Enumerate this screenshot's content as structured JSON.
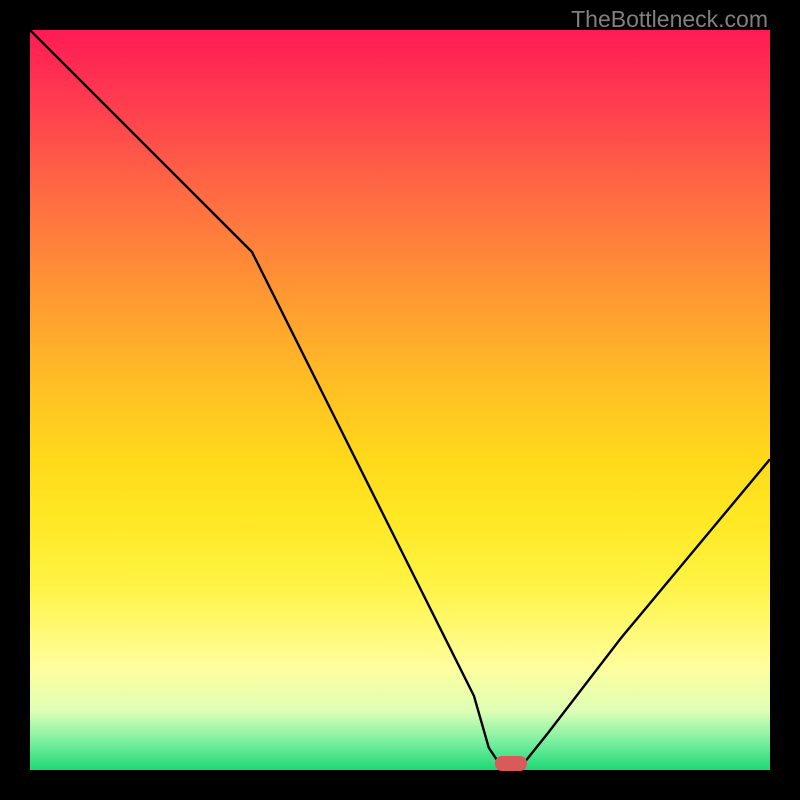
{
  "watermark": "TheBottleneck.com",
  "chart_data": {
    "type": "line",
    "title": "",
    "xlabel": "",
    "ylabel": "",
    "xlim": [
      0,
      100
    ],
    "ylim": [
      0,
      100
    ],
    "x": [
      0,
      10,
      20,
      30,
      40,
      50,
      60,
      62,
      64,
      66,
      70,
      80,
      90,
      100
    ],
    "values": [
      100,
      90,
      80,
      70,
      50,
      30,
      10,
      3,
      0,
      0,
      5,
      18,
      30,
      42
    ],
    "optimum_x": 65,
    "colors": {
      "top": "#ff1b54",
      "mid": "#ffd91a",
      "bottom": "#1ed877",
      "curve": "#000000",
      "marker": "#d85a5a"
    }
  }
}
